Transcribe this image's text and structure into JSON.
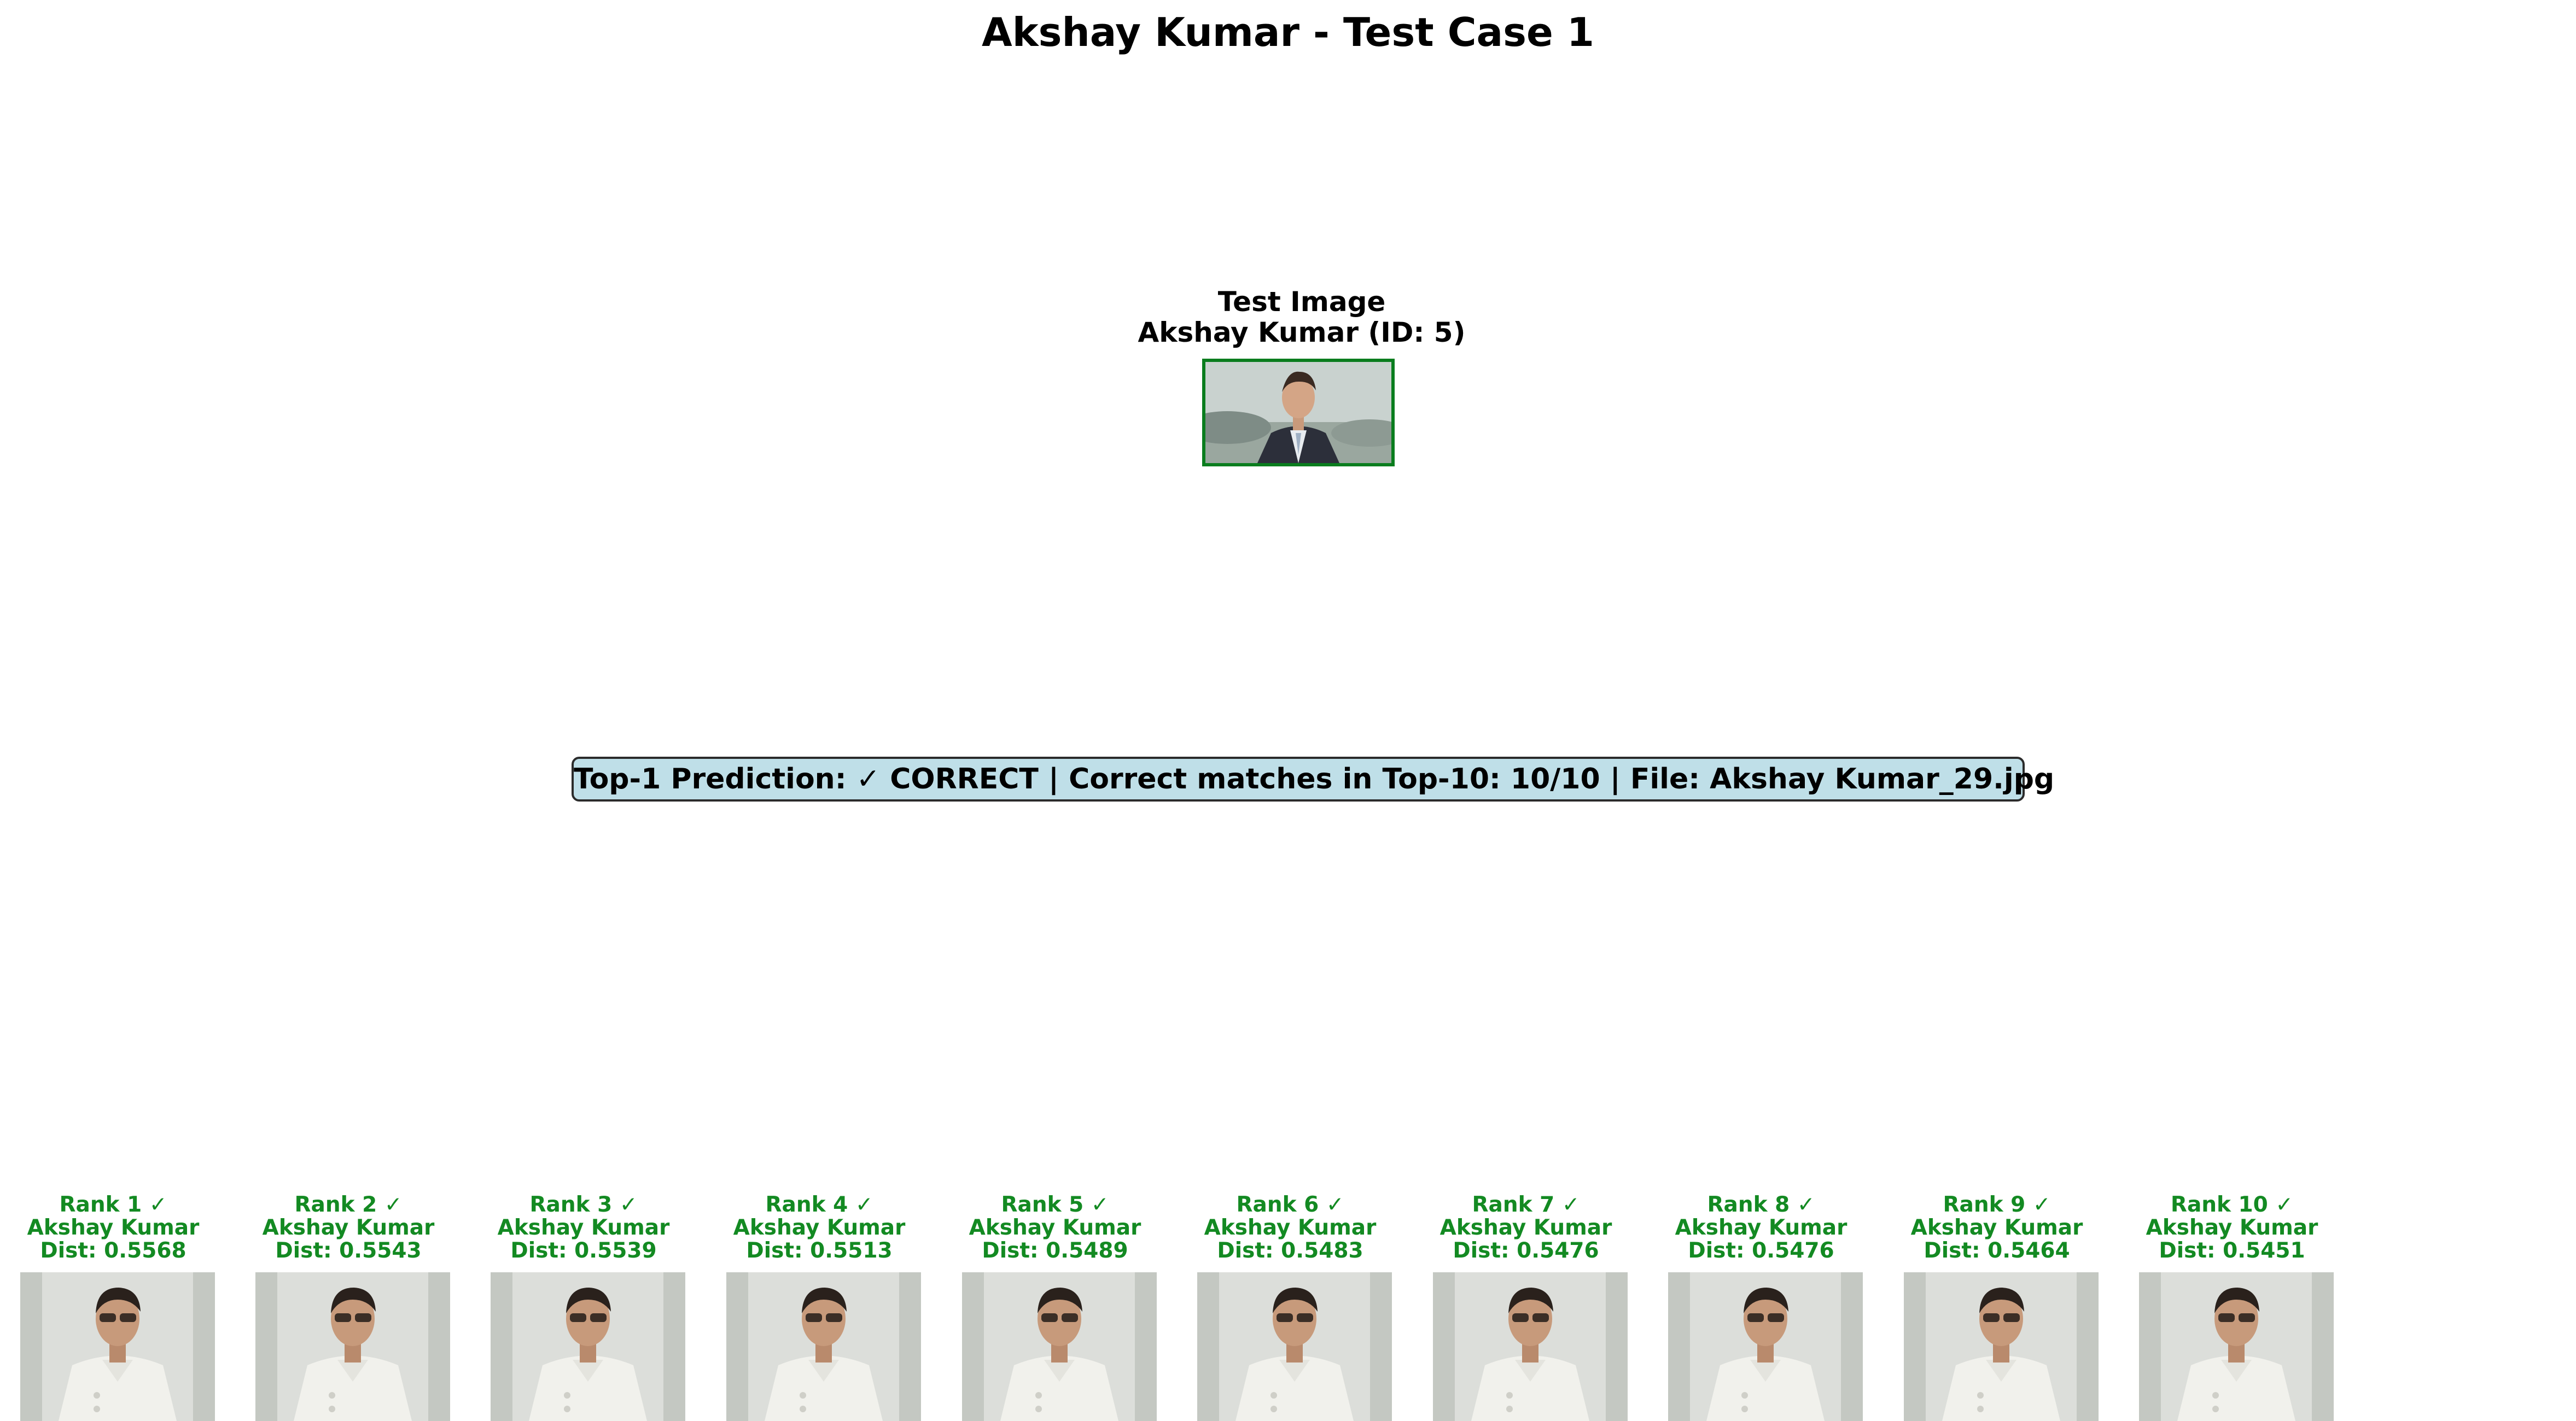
{
  "title": "Akshay Kumar - Test Case 1",
  "test": {
    "heading": "Test Image",
    "subject": "Akshay Kumar (ID: 5)",
    "border_color": "#0a7d1e",
    "image_icon": "person-photo-icon"
  },
  "summary": {
    "text": "Top-1 Prediction: ✓ CORRECT | Correct matches in Top-10: 10/10 | File: Akshay Kumar_29.jpg",
    "background": "#bfdfe8"
  },
  "matches": [
    {
      "rank": "Rank 1 ✓",
      "name": "Akshay Kumar",
      "dist": "Dist: 0.5568"
    },
    {
      "rank": "Rank 2 ✓",
      "name": "Akshay Kumar",
      "dist": "Dist: 0.5543"
    },
    {
      "rank": "Rank 3 ✓",
      "name": "Akshay Kumar",
      "dist": "Dist: 0.5539"
    },
    {
      "rank": "Rank 4 ✓",
      "name": "Akshay Kumar",
      "dist": "Dist: 0.5513"
    },
    {
      "rank": "Rank 5 ✓",
      "name": "Akshay Kumar",
      "dist": "Dist: 0.5489"
    },
    {
      "rank": "Rank 6 ✓",
      "name": "Akshay Kumar",
      "dist": "Dist: 0.5483"
    },
    {
      "rank": "Rank 7 ✓",
      "name": "Akshay Kumar",
      "dist": "Dist: 0.5476"
    },
    {
      "rank": "Rank 8 ✓",
      "name": "Akshay Kumar",
      "dist": "Dist: 0.5476"
    },
    {
      "rank": "Rank 9 ✓",
      "name": "Akshay Kumar",
      "dist": "Dist: 0.5464"
    },
    {
      "rank": "Rank 10 ✓",
      "name": "Akshay Kumar",
      "dist": "Dist: 0.5451"
    }
  ],
  "colors": {
    "match_text": "#138a22"
  }
}
